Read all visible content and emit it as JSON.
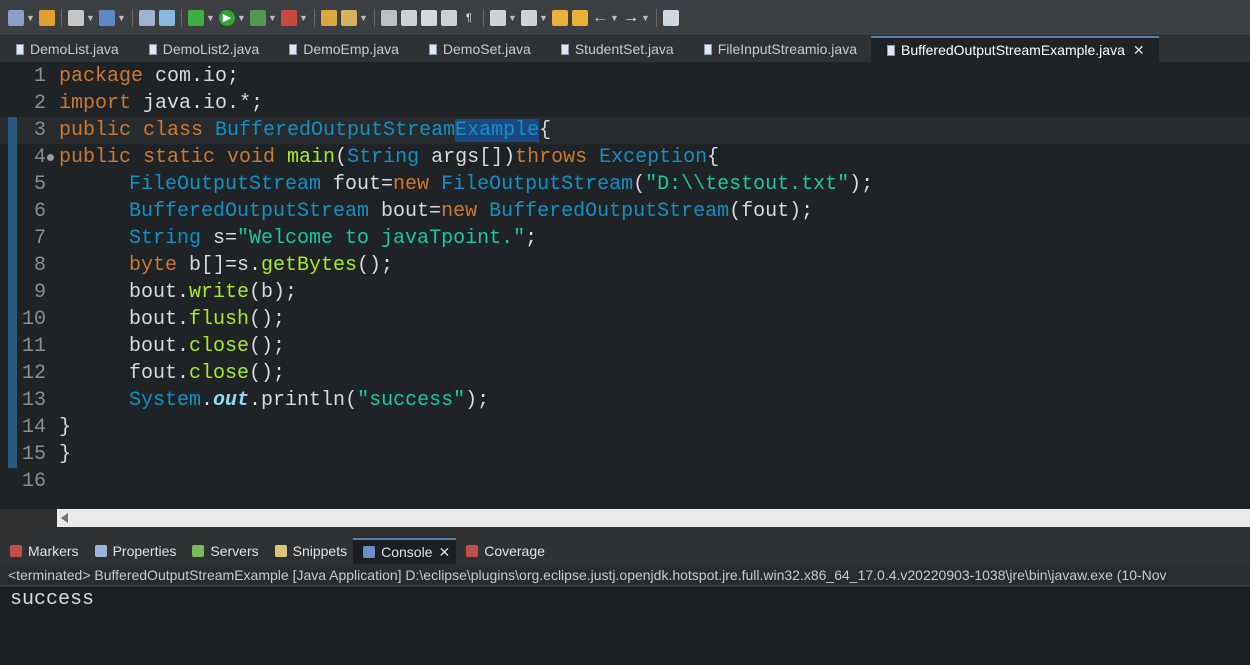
{
  "toolbar": {
    "icons": [
      "new-file-icon",
      "save-icon",
      "print-icon",
      "build-icon",
      "debug-icon",
      "run-icon",
      "run-dropdown-icon",
      "external-tools-icon",
      "new-java-project-icon",
      "new-package-icon",
      "new-class-icon",
      "open-type-icon",
      "search-icon",
      "toggle-mark-icon",
      "show-whitespace-icon",
      "word-wrap-icon",
      "annotation-icon",
      "next-annotation-icon",
      "prev-annotation-icon",
      "back-icon",
      "forward-icon",
      "pin-editor-icon"
    ]
  },
  "tabs": [
    {
      "label": "DemoList.java",
      "active": false
    },
    {
      "label": "DemoList2.java",
      "active": false
    },
    {
      "label": "DemoEmp.java",
      "active": false
    },
    {
      "label": "DemoSet.java",
      "active": false
    },
    {
      "label": "StudentSet.java",
      "active": false
    },
    {
      "label": "FileInputStreamio.java",
      "active": false
    },
    {
      "label": "BufferedOutputStreamExample.java",
      "active": true,
      "close": "✕"
    }
  ],
  "editor": {
    "lines": [
      {
        "n": "1"
      },
      {
        "n": "2"
      },
      {
        "n": "3"
      },
      {
        "n": "4"
      },
      {
        "n": "5"
      },
      {
        "n": "6"
      },
      {
        "n": "7"
      },
      {
        "n": "8"
      },
      {
        "n": "9"
      },
      {
        "n": "10"
      },
      {
        "n": "11"
      },
      {
        "n": "12"
      },
      {
        "n": "13"
      },
      {
        "n": "14"
      },
      {
        "n": "15"
      },
      {
        "n": "16"
      }
    ],
    "code": {
      "l1_kw": "package",
      "l1_rest": " com.io;",
      "l2_kw": "import",
      "l2_rest": " java.io.*;",
      "l3_kw": "public class",
      "l3_ty": " BufferedOutputStream",
      "l3_hl": "Example",
      "l3_rest": "{",
      "l4_kw": "public static void",
      "l4_me": " main",
      "l4_p1": "(",
      "l4_ty1": "String",
      "l4_p2": " args[])",
      "l4_kw2": "throws",
      "l4_ty2": " Exception",
      "l4_p3": "{",
      "l5_ty": "FileOutputStream",
      "l5_p1": " fout=",
      "l5_kw": "new",
      "l5_ty2": " FileOutputStream",
      "l5_p2": "(",
      "l5_st": "\"D:\\\\testout.txt\"",
      "l5_p3": ");",
      "l6_ty": "BufferedOutputStream",
      "l6_p1": " bout=",
      "l6_kw": "new",
      "l6_ty2": " BufferedOutputStream",
      "l6_p2": "(fout);",
      "l7_ty": "String",
      "l7_p1": " s=",
      "l7_st": "\"Welcome to javaTpoint.\"",
      "l7_p2": ";",
      "l8_kw": "byte",
      "l8_p1": " b[]=s.",
      "l8_me": "getBytes",
      "l8_p2": "();",
      "l9_p1": "bout.",
      "l9_me": "write",
      "l9_p2": "(b);",
      "l10_p1": "bout.",
      "l10_me": "flush",
      "l10_p2": "();",
      "l11_p1": "bout.",
      "l11_me": "close",
      "l11_p2": "();",
      "l12_p1": "fout.",
      "l12_me": "close",
      "l12_p2": "();",
      "l13_ty": "System",
      "l13_p1": ".",
      "l13_fi": "out",
      "l13_p2": ".println(",
      "l13_st": "\"success\"",
      "l13_p3": ");",
      "l14": "}",
      "l15": "}"
    }
  },
  "panel": {
    "tabs": [
      {
        "label": "Markers",
        "icon": "markers-icon",
        "color": "#c0504d"
      },
      {
        "label": "Properties",
        "icon": "properties-icon",
        "color": "#9db4d6"
      },
      {
        "label": "Servers",
        "icon": "servers-icon",
        "color": "#7bb661"
      },
      {
        "label": "Snippets",
        "icon": "snippets-icon",
        "color": "#d6c77a"
      },
      {
        "label": "Console",
        "icon": "console-icon",
        "color": "#6b8fc7",
        "active": true,
        "close": "✕"
      },
      {
        "label": "Coverage",
        "icon": "coverage-icon",
        "color": "#c0504d"
      }
    ],
    "status": "<terminated> BufferedOutputStreamExample [Java Application] D:\\eclipse\\plugins\\org.eclipse.justj.openjdk.hotspot.jre.full.win32.x86_64_17.0.4.v20220903-1038\\jre\\bin\\javaw.exe  (10-Nov",
    "output": "success"
  }
}
